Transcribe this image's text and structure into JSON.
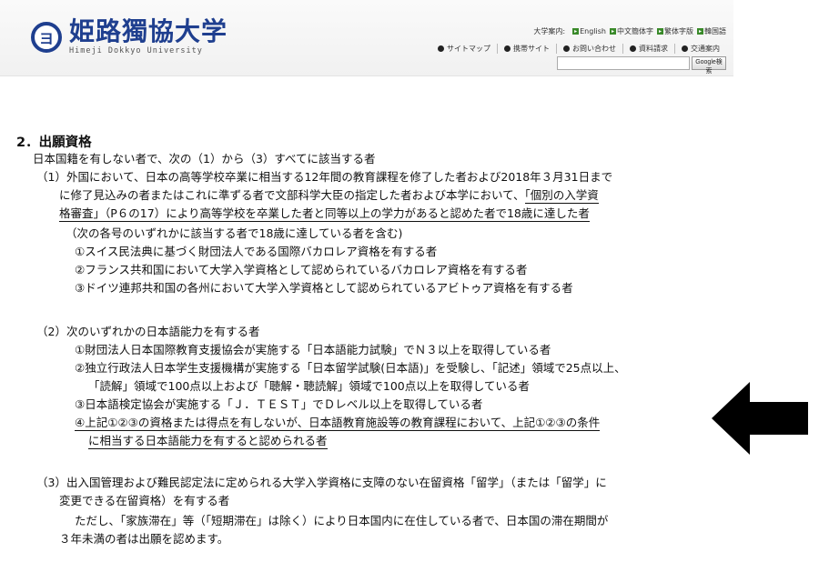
{
  "header": {
    "logo_emblem": "ヨ",
    "logo_jp": "姫路獨協大学",
    "logo_en": "Himeji Dokkyo University",
    "lang_label": "大学案内:",
    "languages": [
      "English",
      "中文簡体字",
      "繁体字版",
      "韓国語"
    ],
    "util_links": [
      "サイトマップ",
      "携帯サイト",
      "お問い合わせ",
      "資料請求",
      "交通案内"
    ],
    "search_value": "",
    "search_button": "Google検索"
  },
  "content": {
    "title": "2．出願資格",
    "intro": "日本国籍を有しない者で、次の（1）から（3）すべてに該当する者",
    "s1": {
      "l1": "（1）外国において、日本の高等学校卒業に相当する12年間の教育課程を修了した者および2018年３月31日まで",
      "l2a": "に修了見込みの者またはこれに準ずる者で文部科学大臣の指定した者および本学において、",
      "l2b": "「個別の入学資",
      "l3a": "格審査」",
      "l3b": "（P６の17）により高等学校を卒業した者と同等以上の学力があると認めた者で18歳に達した者",
      "l4": "（次の各号のいずれかに該当する者で18歳に達している者を含む)",
      "l5": "①スイス民法典に基づく財団法人である国際バカロレア資格を有する者",
      "l6": "②フランス共和国において大学入学資格として認められているバカロレア資格を有する者",
      "l7": "③ドイツ連邦共和国の各州において大学入学資格として認められているアビトゥア資格を有する者"
    },
    "s2": {
      "l1": "（2）次のいずれかの日本語能力を有する者",
      "l2": "①財団法人日本国際教育支援協会が実施する「日本語能力試験」でＮ３以上を取得している者",
      "l3": "②独立行政法人日本学生支援機構が実施する「日本留学試験(日本語)」を受験し、「記述」領域で25点以上、",
      "l4": "「読解」領域で100点以上および「聴解・聴読解」領域で100点以上を取得している者",
      "l5": "③日本語検定協会が実施する「Ｊ．ＴＥＳＴ」でＤレベル以上を取得している者",
      "l6": "④上記①②③の資格または得点を有しないが、日本語教育施設等の教育課程において、上記①②③の条件",
      "l7": "に相当する日本語能力を有すると認められる者"
    },
    "s3": {
      "l1": "（3）出入国管理および難民認定法に定められる大学入学資格に支障のない在留資格「留学」（または「留学」に",
      "l2": "変更できる在留資格）を有する者",
      "l3": "ただし、「家族滞在」等（「短期滞在」は除く）により日本国内に在住している者で、日本国の滞在期間が",
      "l4": "３年未満の者は出願を認めます。"
    }
  }
}
